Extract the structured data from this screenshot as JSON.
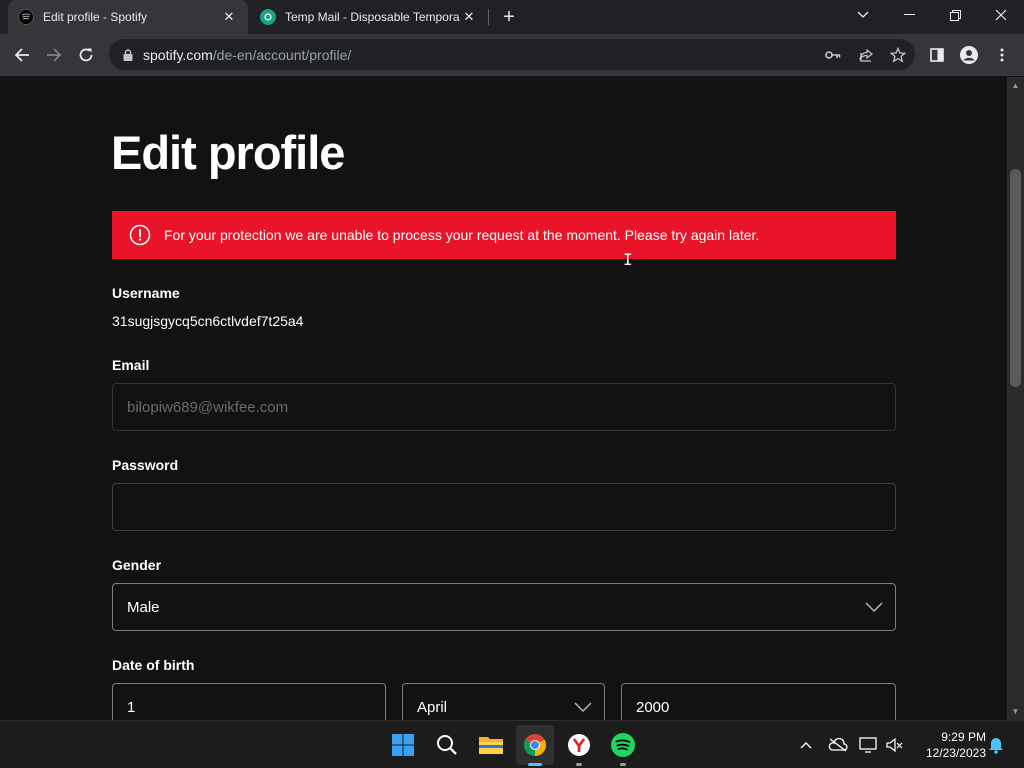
{
  "browser": {
    "tabs": [
      {
        "title": "Edit profile - Spotify",
        "active": true
      },
      {
        "title": "Temp Mail - Disposable Tempora",
        "active": false
      }
    ],
    "url_host": "spotify.com",
    "url_path": "/de-en/account/profile/"
  },
  "page": {
    "heading": "Edit profile",
    "alert_text": "For your protection we are unable to process your request at the moment. Please try again later.",
    "username_label": "Username",
    "username_value": "31sugjsgycq5cn6ctlvdef7t25a4",
    "email_label": "Email",
    "email_value": "bilopiw689@wikfee.com",
    "password_label": "Password",
    "password_value": "",
    "gender_label": "Gender",
    "gender_value": "Male",
    "dob_label": "Date of birth",
    "dob_day": "1",
    "dob_month": "April",
    "dob_year": "2000"
  },
  "taskbar": {
    "time": "9:29 PM",
    "date": "12/23/2023",
    "apps": [
      "windows-start",
      "search",
      "file-explorer",
      "chrome",
      "yandex",
      "spotify"
    ]
  },
  "colors": {
    "page_bg": "#121212",
    "alert_bg": "#e91429",
    "spotify_green": "#1ed760"
  }
}
